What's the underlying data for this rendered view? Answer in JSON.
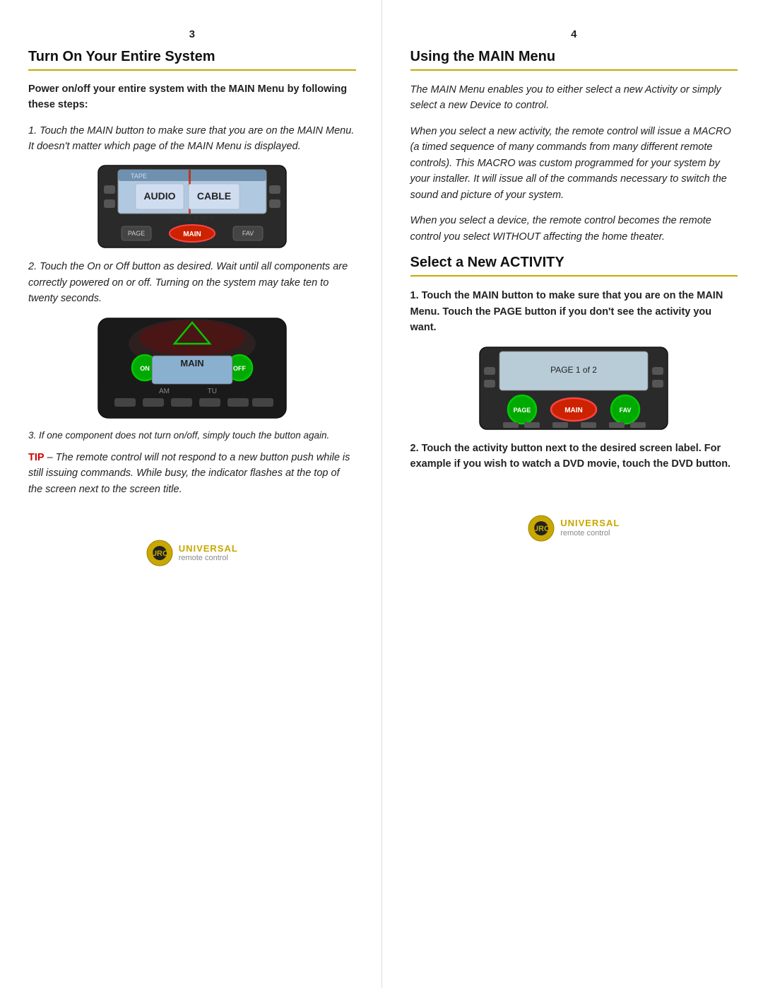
{
  "left": {
    "page_number": "3",
    "section_title": "Turn On Your Entire System",
    "bold_intro": "Power on/off your entire system with the MAIN Menu by following these steps:",
    "step1": "1. Touch the MAIN button to make sure that you are on the MAIN Menu. It doesn't matter which page of the MAIN Menu is displayed.",
    "step2": "2. Touch the On or Off button as desired. Wait until all components are correctly powered on or off. Turning on the system may take ten to twenty seconds.",
    "step3_caption": "3. If one component does not turn on/off, simply touch the button again.",
    "tip_label": "TIP",
    "tip_text": " – The remote control will not respond to a new button push while is still issuing commands. While busy, the  indicator flashes at the top of the screen next to the screen title."
  },
  "right": {
    "page_number": "4",
    "section_title_1": "Using the MAIN Menu",
    "para1": "The MAIN Menu enables you to either select a new Activity or simply select a new Device to control.",
    "para2": "When you select a new activity, the remote control will issue a MACRO (a timed sequence of many commands from many different remote controls). This MACRO was custom programmed for your system by your installer. It will issue all of the commands necessary to switch the sound and picture of your system.",
    "para3": "When you select a device, the remote control becomes the remote control you select WITHOUT affecting the home theater.",
    "section_title_2": "Select a New ACTIVITY",
    "step1_bold": "1. Touch the MAIN button to make sure that you are on the MAIN Menu. Touch the PAGE button if you don't see the activity you want.",
    "step2_bold": "2. Touch the activity button next to the desired screen label. For example if you wish to watch a DVD movie, touch the DVD button."
  },
  "logo": {
    "universal": "UNIVERSAL",
    "remote_control": "remote control"
  }
}
